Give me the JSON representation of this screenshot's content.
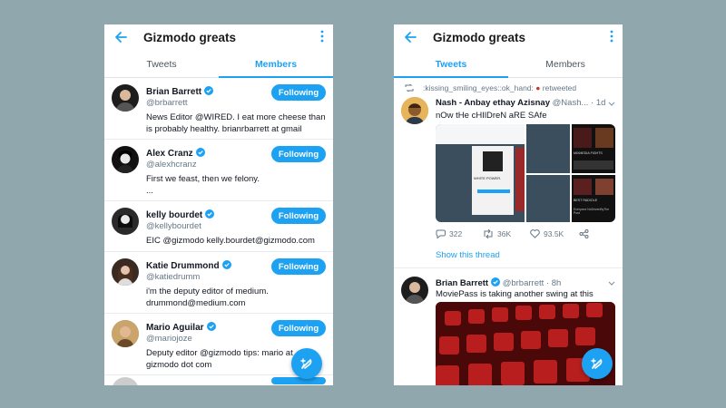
{
  "colors": {
    "accent": "#1da1f2",
    "background": "#90a7ae"
  },
  "left": {
    "title": "Gizmodo greats",
    "tabs": [
      {
        "label": "Tweets",
        "active": false
      },
      {
        "label": "Members",
        "active": true
      }
    ],
    "members": [
      {
        "name": "Brian Barrett",
        "handle": "@brbarrett",
        "bio": "News Editor @WIRED. I eat more cheese than is probably healthy. brianrbarrett at gmail",
        "button": "Following",
        "verified": true
      },
      {
        "name": "Alex Cranz",
        "handle": "@alexhcranz",
        "bio": "First we feast, then we felony.\n...",
        "button": "Following",
        "verified": true
      },
      {
        "name": "kelly bourdet",
        "handle": "@kellybourdet",
        "bio": "EIC @gizmodo kelly.bourdet@gizmodo.com",
        "button": "Following",
        "verified": true
      },
      {
        "name": "Katie Drummond",
        "handle": "@katiedrumm",
        "bio": "i'm the deputy editor of medium. drummond@medium.com",
        "button": "Following",
        "verified": true
      },
      {
        "name": "Mario Aguilar",
        "handle": "@mariojoze",
        "bio": "Deputy editor @gizmodo tips: mario at gizmodo dot com",
        "button": "Following",
        "verified": true
      }
    ]
  },
  "right": {
    "title": "Gizmodo greats",
    "tabs": [
      {
        "label": "Tweets",
        "active": true
      },
      {
        "label": "Members",
        "active": false
      }
    ],
    "tweets": [
      {
        "retweet_text": ":kissing_smiling_eyes::ok_hand:",
        "retweet_suffix": "retweeted",
        "name": "Nash - Anbay ethay Azisnay",
        "meta": "@Nash... · 1d",
        "text": "nOw tHe cHIlDreN aRE SAfe",
        "replies": "322",
        "retweets": "36K",
        "likes": "93.5K",
        "show_thread": "Show this thread",
        "media_labels": [
          "WHITE POWER.",
          "MIXMEDIA FIGHTS",
          "BEST RADIOLE",
          "Everyone NoDrivenByThe Post"
        ]
      },
      {
        "name": "Brian Barrett",
        "meta": "@brbarrett · 8h",
        "text": "MoviePass is taking another swing at this",
        "verified": true
      }
    ]
  }
}
